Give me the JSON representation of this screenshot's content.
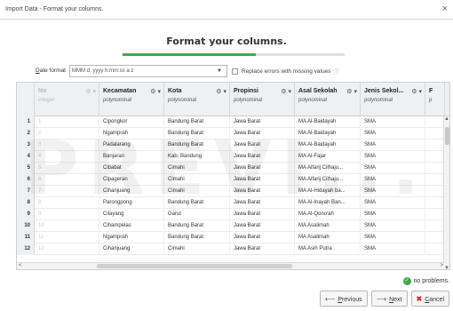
{
  "window": {
    "title": "Import Data - Format your columns."
  },
  "page": {
    "heading": "Format your columns.",
    "progress": 0.6
  },
  "date_format": {
    "label_prefix": "D",
    "label_rest": "ate format",
    "value": "MMM d, yyyy h:mm:ss a z"
  },
  "replace_errors": {
    "label": "Replace errors with missing values",
    "checked": false
  },
  "columns": [
    {
      "name": "No",
      "type": "integer",
      "dim": true
    },
    {
      "name": "Kecamatan",
      "type": "polynominal"
    },
    {
      "name": "Kota",
      "type": "polynominal"
    },
    {
      "name": "Propinsi",
      "type": "polynominal"
    },
    {
      "name": "Asal Sekolah",
      "type": "polynominal"
    },
    {
      "name": "Jenis Sekol...",
      "type": "polynominal"
    },
    {
      "name": "F",
      "type": "p"
    }
  ],
  "rows": [
    {
      "n": "1",
      "no": "1",
      "kec": "Cipongkor",
      "kota": "Bandung Barat",
      "prop": "Jawa Barat",
      "asal": "MA Al-Baidayah",
      "jenis": "SMA",
      "f": ""
    },
    {
      "n": "2",
      "no": "2",
      "kec": "Ngamprah",
      "kota": "Bandung Barat",
      "prop": "Jawa Barat",
      "asal": "MA Al-Baidayah",
      "jenis": "SMA",
      "f": ""
    },
    {
      "n": "3",
      "no": "3",
      "kec": "Padalarang",
      "kota": "Bandung Barat",
      "prop": "Jawa Barat",
      "asal": "MA Al-Baidayah",
      "jenis": "SMA",
      "f": ""
    },
    {
      "n": "4",
      "no": "4",
      "kec": "Banjaran",
      "kota": "Kab. Bandung",
      "prop": "Jawa Barat",
      "asal": "MA Al-Fajar",
      "jenis": "SMA",
      "f": ""
    },
    {
      "n": "5",
      "no": "5",
      "kec": "Cibabat",
      "kota": "Cimahi",
      "prop": "Jawa Barat",
      "asal": "MA Alfarij Cilhaju...",
      "jenis": "SMA",
      "f": ""
    },
    {
      "n": "6",
      "no": "6",
      "kec": "Cipageran",
      "kota": "Cimahi",
      "prop": "Jawa Barat",
      "asal": "MA Alfarij Cilhaju...",
      "jenis": "SMA",
      "f": ""
    },
    {
      "n": "7",
      "no": "7",
      "kec": "Cihanjuang",
      "kota": "Cimahi",
      "prop": "Jawa Barat",
      "asal": "MA Al-Hidayah ba...",
      "jenis": "SMA",
      "f": ""
    },
    {
      "n": "8",
      "no": "8",
      "kec": "Parongpong",
      "kota": "Bandung Barat",
      "prop": "Jawa Barat",
      "asal": "MA Al-Inayah Ban...",
      "jenis": "SMA",
      "f": ""
    },
    {
      "n": "9",
      "no": "9",
      "kec": "Cilayang",
      "kota": "Garut",
      "prop": "Jawa Barat",
      "asal": "MA Al-Qono'ah",
      "jenis": "SMA",
      "f": ""
    },
    {
      "n": "10",
      "no": "10",
      "kec": "Cihampelas",
      "kota": "Bandung Barat",
      "prop": "Jawa Barat",
      "asal": "MA Asalimah",
      "jenis": "SMA",
      "f": ""
    },
    {
      "n": "11",
      "no": "11",
      "kec": "Ngamprah",
      "kota": "Bandung Barat",
      "prop": "Jawa Barat",
      "asal": "MA Asalimah",
      "jenis": "SMA",
      "f": ""
    },
    {
      "n": "12",
      "no": "12",
      "kec": "Cihanjuang",
      "kota": "Cimahi",
      "prop": "Jawa Barat",
      "asal": "MA Asih Putra",
      "jenis": "SMA",
      "f": ""
    }
  ],
  "watermark": "PREVI...",
  "status": {
    "text": "no problems."
  },
  "buttons": {
    "previous": {
      "underline": "P",
      "rest": "revious"
    },
    "next": {
      "underline": "N",
      "rest": "ext"
    },
    "cancel": {
      "underline": "C",
      "rest": "ancel"
    }
  },
  "colors": {
    "accent": "#3daa4a",
    "cancel": "#d9342b"
  },
  "icons": {
    "gear": "gear-icon",
    "close": "close-icon",
    "info": "info-icon",
    "check": "check-circle-icon",
    "prev": "arrow-left-icon",
    "next": "arrow-right-icon",
    "cancel": "cancel-x-icon"
  }
}
